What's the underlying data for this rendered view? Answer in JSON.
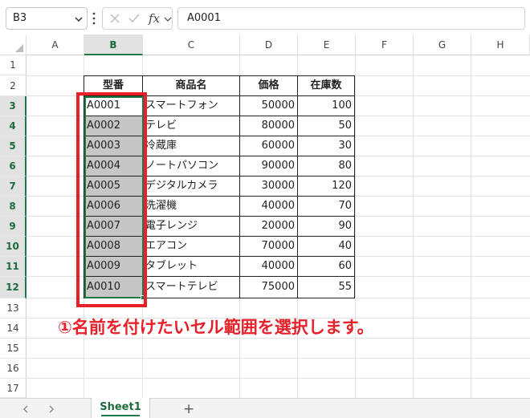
{
  "formula_bar": {
    "name_box": "B3",
    "fx_label": "fx",
    "value": "A0001"
  },
  "columns": [
    "A",
    "B",
    "C",
    "D",
    "E",
    "F",
    "G",
    "H"
  ],
  "selected_column": "B",
  "rows": [
    "1",
    "2",
    "3",
    "4",
    "5",
    "6",
    "7",
    "8",
    "9",
    "10",
    "11",
    "12",
    "13",
    "14",
    "15",
    "16",
    "17"
  ],
  "table": {
    "headers": [
      "型番",
      "商品名",
      "価格",
      "在庫数"
    ],
    "rows": [
      [
        "A0001",
        "スマートフォン",
        "50000",
        "100"
      ],
      [
        "A0002",
        "テレビ",
        "80000",
        "50"
      ],
      [
        "A0003",
        "冷蔵庫",
        "60000",
        "30"
      ],
      [
        "A0004",
        "ノートパソコン",
        "90000",
        "80"
      ],
      [
        "A0005",
        "デジタルカメラ",
        "30000",
        "120"
      ],
      [
        "A0006",
        "洗濯機",
        "40000",
        "70"
      ],
      [
        "A0007",
        "電子レンジ",
        "20000",
        "90"
      ],
      [
        "A0008",
        "エアコン",
        "70000",
        "40"
      ],
      [
        "A0009",
        "タブレット",
        "40000",
        "60"
      ],
      [
        "A0010",
        "スマートテレビ",
        "75000",
        "55"
      ]
    ]
  },
  "annotation": "①名前を付けたいセル範囲を選択します。",
  "sheet_tabs": [
    "Sheet1"
  ],
  "add_sheet_label": "+",
  "colors": {
    "selection_green": "#1d7a44",
    "highlight_red": "#e8202a",
    "selected_fill": "#c6c6c6"
  }
}
